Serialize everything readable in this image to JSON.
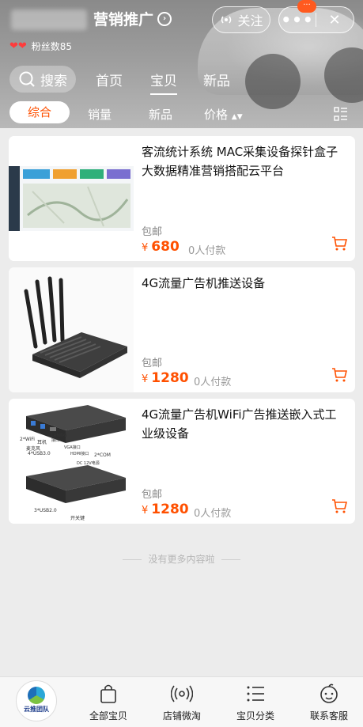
{
  "header": {
    "shop_title": "营销推广",
    "follow_label": "关注",
    "more_badge": "···",
    "fans_label": "粉丝数85"
  },
  "nav": {
    "search_label": "搜索",
    "tabs": [
      "首页",
      "宝贝",
      "新品"
    ],
    "active_tab": "宝贝"
  },
  "filters": {
    "items": [
      "综合",
      "销量",
      "新品",
      "价格"
    ],
    "active": "综合",
    "price_sort_icon": "up-down-arrow"
  },
  "products": [
    {
      "title": "客流统计系统 MAC采集设备探针盒子大数据精准营销搭配云平台",
      "shipping": "包邮",
      "currency": "¥",
      "price": "680",
      "payers": "0人付款"
    },
    {
      "title": "4G流量广告机推送设备",
      "shipping": "包邮",
      "currency": "¥",
      "price": "1280",
      "payers": "0人付款"
    },
    {
      "title": "4G流量广告机WiFi广告推送嵌入式工业级设备",
      "shipping": "包邮",
      "currency": "¥",
      "price": "1280",
      "payers": "0人付款",
      "image_labels": [
        "2*WiFi",
        "麦克风",
        "耳机",
        "LAN网络接口",
        "VGA接口",
        "HDMI接口",
        "2*COM",
        "4*USB3.0",
        "DC 12V电源",
        "3*USB2.0",
        "开关键"
      ]
    }
  ],
  "list_end": "没有更多内容啦",
  "bottom_bar": {
    "logo_text": "云推团队",
    "tabs": [
      {
        "label": "全部宝贝",
        "icon": "bag-icon"
      },
      {
        "label": "店铺微淘",
        "icon": "broadcast-icon"
      },
      {
        "label": "宝贝分类",
        "icon": "list-icon"
      },
      {
        "label": "联系客服",
        "icon": "service-face-icon"
      }
    ]
  },
  "colors": {
    "accent": "#ff5000",
    "background": "#ececec"
  }
}
